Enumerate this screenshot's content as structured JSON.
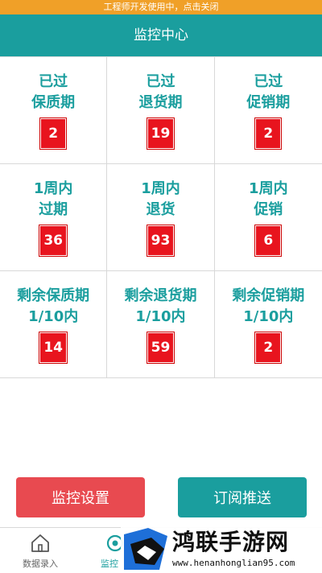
{
  "banner": {
    "text": "工程师开发使用中，点击关闭"
  },
  "header": {
    "title": "监控中心"
  },
  "monitor_cells": [
    {
      "line1": "已过",
      "line2": "保质期",
      "count": "2"
    },
    {
      "line1": "已过",
      "line2": "退货期",
      "count": "19"
    },
    {
      "line1": "已过",
      "line2": "促销期",
      "count": "2"
    },
    {
      "line1": "1周内",
      "line2": "过期",
      "count": "36"
    },
    {
      "line1": "1周内",
      "line2": "退货",
      "count": "93"
    },
    {
      "line1": "1周内",
      "line2": "促销",
      "count": "6"
    },
    {
      "line1": "剩余保质期",
      "line2": "1/10内",
      "count": "14"
    },
    {
      "line1": "剩余退货期",
      "line2": "1/10内",
      "count": "59"
    },
    {
      "line1": "剩余促销期",
      "line2": "1/10内",
      "count": "2"
    }
  ],
  "actions": {
    "settings_label": "监控设置",
    "subscribe_label": "订阅推送"
  },
  "tabs": [
    {
      "label": "数据录入",
      "icon": "home-icon",
      "active": false
    },
    {
      "label": "监控",
      "icon": "monitor-icon",
      "active": true
    }
  ],
  "watermark": {
    "text": "鸿联手游网",
    "url": "www.henanhonglian95.com"
  },
  "colors": {
    "primary": "#1a9e9e",
    "banner": "#f0a028",
    "badge": "#e8141e",
    "danger_button": "#e84a50"
  }
}
